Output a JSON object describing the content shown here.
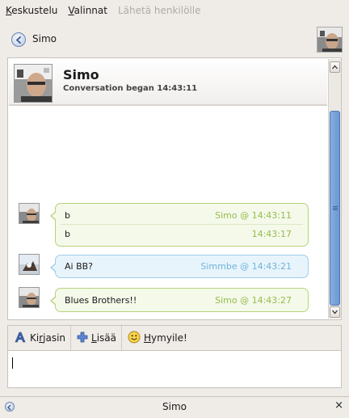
{
  "menubar": {
    "items": [
      {
        "label": "Keskustelu",
        "accel": "K",
        "rest": "eskustelu",
        "enabled": true
      },
      {
        "label": "Valinnat",
        "accel": "V",
        "rest": "alinnat",
        "enabled": true
      },
      {
        "label": "Lähetä henkilölle",
        "enabled": false
      }
    ]
  },
  "contact": {
    "name": "Simo",
    "back_icon": "back-arrow-icon"
  },
  "chat_header": {
    "name": "Simo",
    "subtitle": "Conversation began 14:43:11"
  },
  "messages": [
    {
      "sender": "Simo",
      "style": "green",
      "lines": [
        {
          "text": "b",
          "time": "Simo @ 14:43:11"
        },
        {
          "text": "b",
          "time": "14:43:17"
        }
      ]
    },
    {
      "sender": "Simmbe",
      "style": "blue",
      "lines": [
        {
          "text": "Ai BB?",
          "time": "Simmbe @ 14:43:21"
        }
      ]
    },
    {
      "sender": "Simo",
      "style": "green",
      "lines": [
        {
          "text": "Blues Brothers!!",
          "time": "Simo @ 14:43:27"
        }
      ]
    }
  ],
  "toolbar": {
    "font": {
      "pre": "Ki",
      "accel": "r",
      "post": "jasin",
      "icon": "font-icon"
    },
    "insert": {
      "pre": "",
      "accel": "L",
      "post": "isää",
      "icon": "plus-icon"
    },
    "smiley": {
      "pre": "",
      "accel": "H",
      "post": "ymyile!",
      "icon": "smiley-icon"
    }
  },
  "input": {
    "value": ""
  },
  "tab": {
    "title": "Simo",
    "close": "×"
  },
  "colors": {
    "accent_green": "#96bc4c",
    "accent_blue": "#6fb4dc",
    "scrollbar": "#6b97d4"
  }
}
